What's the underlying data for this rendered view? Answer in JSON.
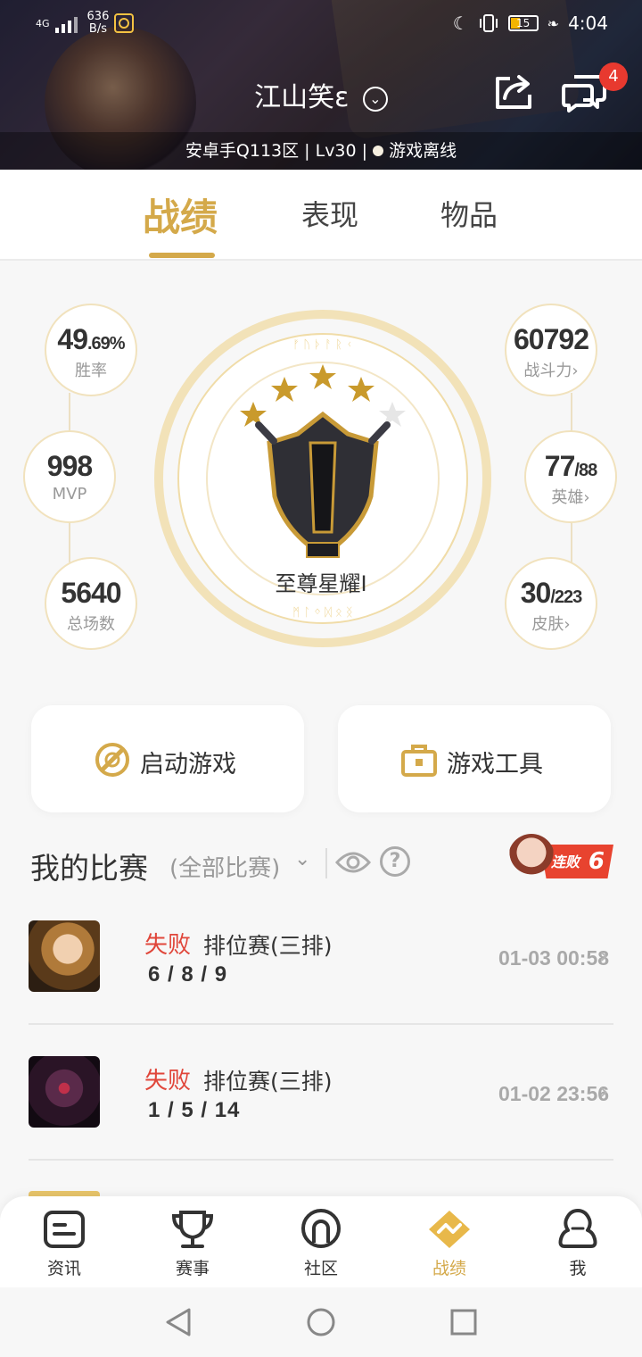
{
  "status_bar": {
    "network": "4G",
    "speed_value": "636",
    "speed_unit": "B/s",
    "battery": "15",
    "time": "4:04"
  },
  "header": {
    "player_name": "江山笑ε",
    "server_info": "安卓手Q113区 | Lv30 |",
    "online_status": "游戏离线",
    "message_badge": "4"
  },
  "tabs": [
    {
      "label": "战绩",
      "active": true
    },
    {
      "label": "表现",
      "active": false
    },
    {
      "label": "物品",
      "active": false
    }
  ],
  "stats": {
    "win_rate_main": "49",
    "win_rate_decimal": ".69%",
    "win_rate_label": "胜率",
    "mvp_value": "998",
    "mvp_label": "MVP",
    "total_value": "5640",
    "total_label": "总场数",
    "power_value": "60792",
    "power_label": "战斗力",
    "heroes_value": "77",
    "heroes_total": "/88",
    "heroes_label": "英雄",
    "skins_value": "30",
    "skins_total": "/223",
    "skins_label": "皮肤",
    "rank_name": "至尊星耀I",
    "rank_stars_filled": 4,
    "rank_stars_total": 5
  },
  "actions": {
    "launch_label": "启动游戏",
    "tools_label": "游戏工具"
  },
  "matches_section": {
    "title": "我的比赛",
    "filter": "(全部比赛)",
    "help": "?",
    "streak_label": "连败",
    "streak_count": "6"
  },
  "matches": [
    {
      "result": "失败",
      "mode": "排位赛(三排)",
      "kda": "6 / 8 / 9",
      "time": "01-03 00:58"
    },
    {
      "result": "失败",
      "mode": "排位赛(三排)",
      "kda": "1 / 5 / 14",
      "time": "01-02 23:56"
    }
  ],
  "bottom_nav": [
    {
      "label": "资讯",
      "icon": "news-icon"
    },
    {
      "label": "赛事",
      "icon": "trophy-icon"
    },
    {
      "label": "社区",
      "icon": "community-icon"
    },
    {
      "label": "战绩",
      "icon": "stats-icon",
      "active": true
    },
    {
      "label": "我",
      "icon": "profile-icon"
    }
  ],
  "colors": {
    "accent_gold": "#d4a94a",
    "loss_red": "#e0463a",
    "badge_red": "#e8392f"
  }
}
